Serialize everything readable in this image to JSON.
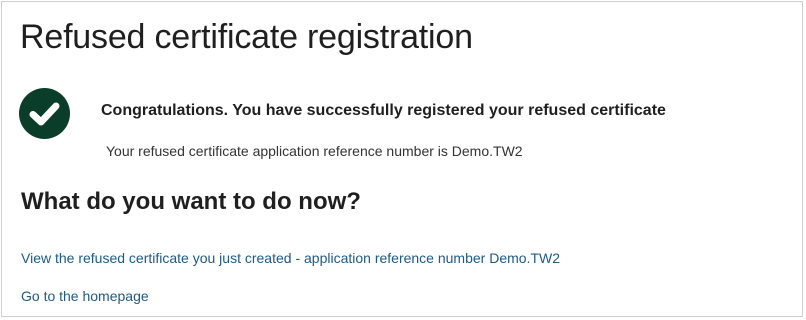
{
  "page": {
    "title": "Refused certificate registration"
  },
  "success": {
    "heading": "Congratulations. You have successfully registered your refused certificate",
    "reference_text": "Your refused certificate application reference number is Demo.TW2",
    "icon": "check-circle-icon",
    "icon_color": "#0b3d2b"
  },
  "next_steps": {
    "heading": "What do you want to do now?",
    "links": [
      {
        "label": "View the refused certificate you just created - application reference number Demo.TW2"
      },
      {
        "label": "Go to the homepage"
      }
    ]
  },
  "colors": {
    "link": "#1d5a86",
    "text": "#1f1f1f"
  }
}
